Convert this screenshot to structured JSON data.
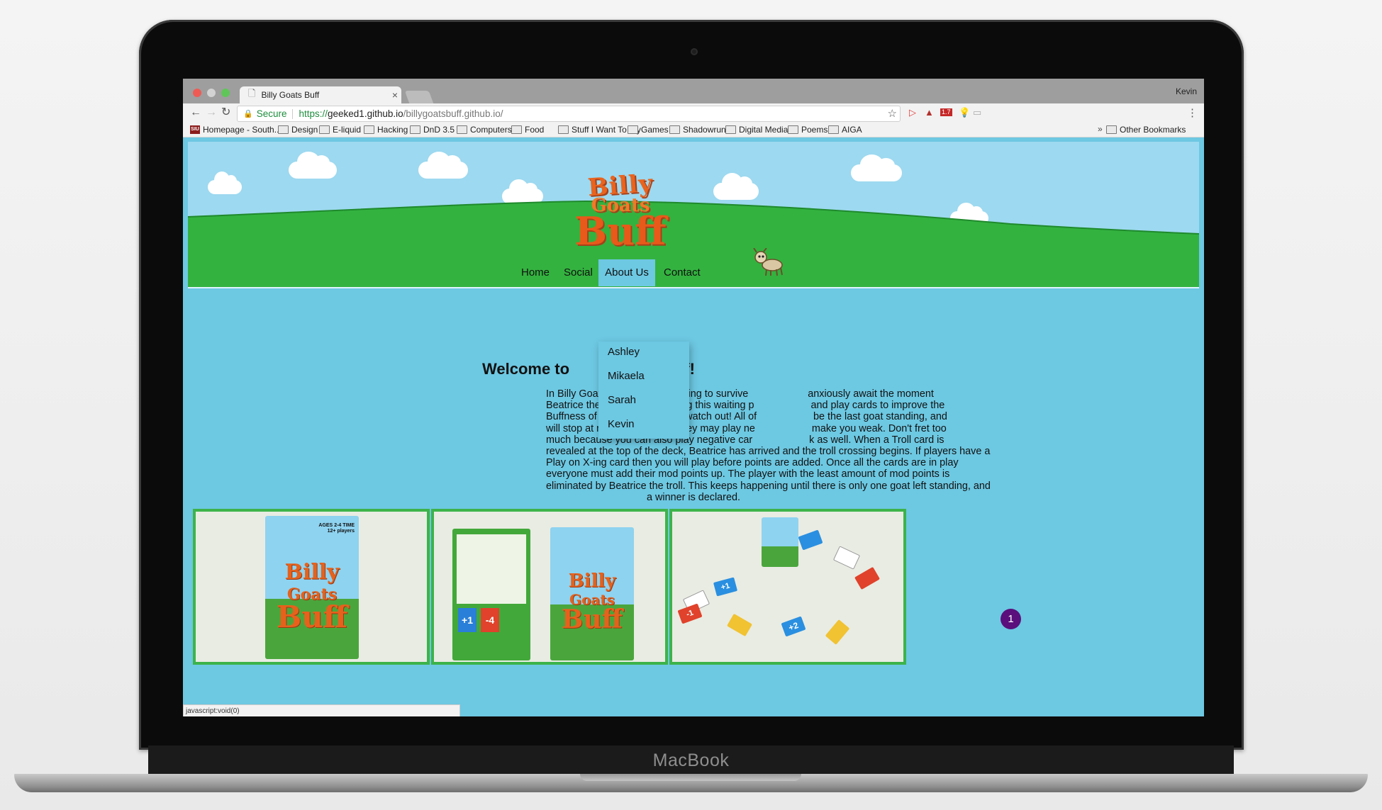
{
  "device": {
    "brand": "MacBook"
  },
  "browser": {
    "tab_title": "Billy Goats Buff",
    "profile_name": "Kevin",
    "secure_label": "Secure",
    "url": {
      "scheme": "https://",
      "host": "geeked1.github.io",
      "path": "/billygoatsbuff.github.io/"
    },
    "status_text": "javascript:void(0)",
    "bookmarks": [
      {
        "label": "Homepage - South...",
        "icon": "siu-favicon"
      },
      {
        "label": "Design",
        "icon": "folder-icon"
      },
      {
        "label": "E-liquid",
        "icon": "folder-icon"
      },
      {
        "label": "Hacking",
        "icon": "folder-icon"
      },
      {
        "label": "DnD 3.5",
        "icon": "folder-icon"
      },
      {
        "label": "Computers",
        "icon": "folder-icon"
      },
      {
        "label": "Food",
        "icon": "folder-icon"
      },
      {
        "label": "Stuff I Want To Try",
        "icon": "folder-icon"
      },
      {
        "label": "Games",
        "icon": "folder-icon"
      },
      {
        "label": "Shadowrun",
        "icon": "folder-icon"
      },
      {
        "label": "Digital Media",
        "icon": "folder-icon"
      },
      {
        "label": "Poems",
        "icon": "folder-icon"
      },
      {
        "label": "AIGA",
        "icon": "folder-icon"
      }
    ],
    "bookmarks_overflow": "»",
    "other_bookmarks": "Other Bookmarks",
    "extension_badge": "1.7"
  },
  "site": {
    "logo": {
      "line1": "Billy",
      "line2": "Goats",
      "line3": "Buff"
    },
    "nav": {
      "home": "Home",
      "social": "Social",
      "about": "About Us",
      "contact": "Contact"
    },
    "about_dropdown": [
      "Ashley",
      "Mikaela",
      "Sarah",
      "Kevin"
    ],
    "welcome_left": "Welcome to",
    "welcome_right": "ff!",
    "intro_lines": [
      "In Billy Goats Buff, you are playing to survive                     anxiously await the moment",
      "Beatrice the Troll Arrives. During this waiting p                    and play cards to improve the",
      "Buffness of your goat. Though watch out! All of                    be the last goat standing, and",
      "will stop at nothing to do so. They may play ne                    make you weak. Don't fret too",
      "much because you can also play negative car                    k as well. When a Troll card is",
      "revealed at the top of the deck, Beatrice has arrived and the troll crossing begins. If players have a",
      "Play on X-ing card then you will play before points are added. Once all the cards are in play",
      "everyone must add their mod points up. The player with the least amount of mod points is",
      "eliminated by Beatrice the troll. This keeps happening until there is only one goat left standing, and",
      "a winner is declared."
    ],
    "box_text": {
      "ages_label": "AGES",
      "ages": "12+",
      "players_range": "2-4",
      "players_label": "players",
      "time_label": "TIME",
      "back_card_plus": "+1",
      "back_card_minus": "-4",
      "card_plus2": "+2",
      "card_minus1": "-1",
      "card_plus1": "+1"
    },
    "chat_badge_count": "1"
  },
  "colors": {
    "page_bg": "#6dc8e2",
    "grass": "#33b23f",
    "sky": "#9dd9f0",
    "frame_green": "#3db34a",
    "badge": "#5a0f7c"
  }
}
